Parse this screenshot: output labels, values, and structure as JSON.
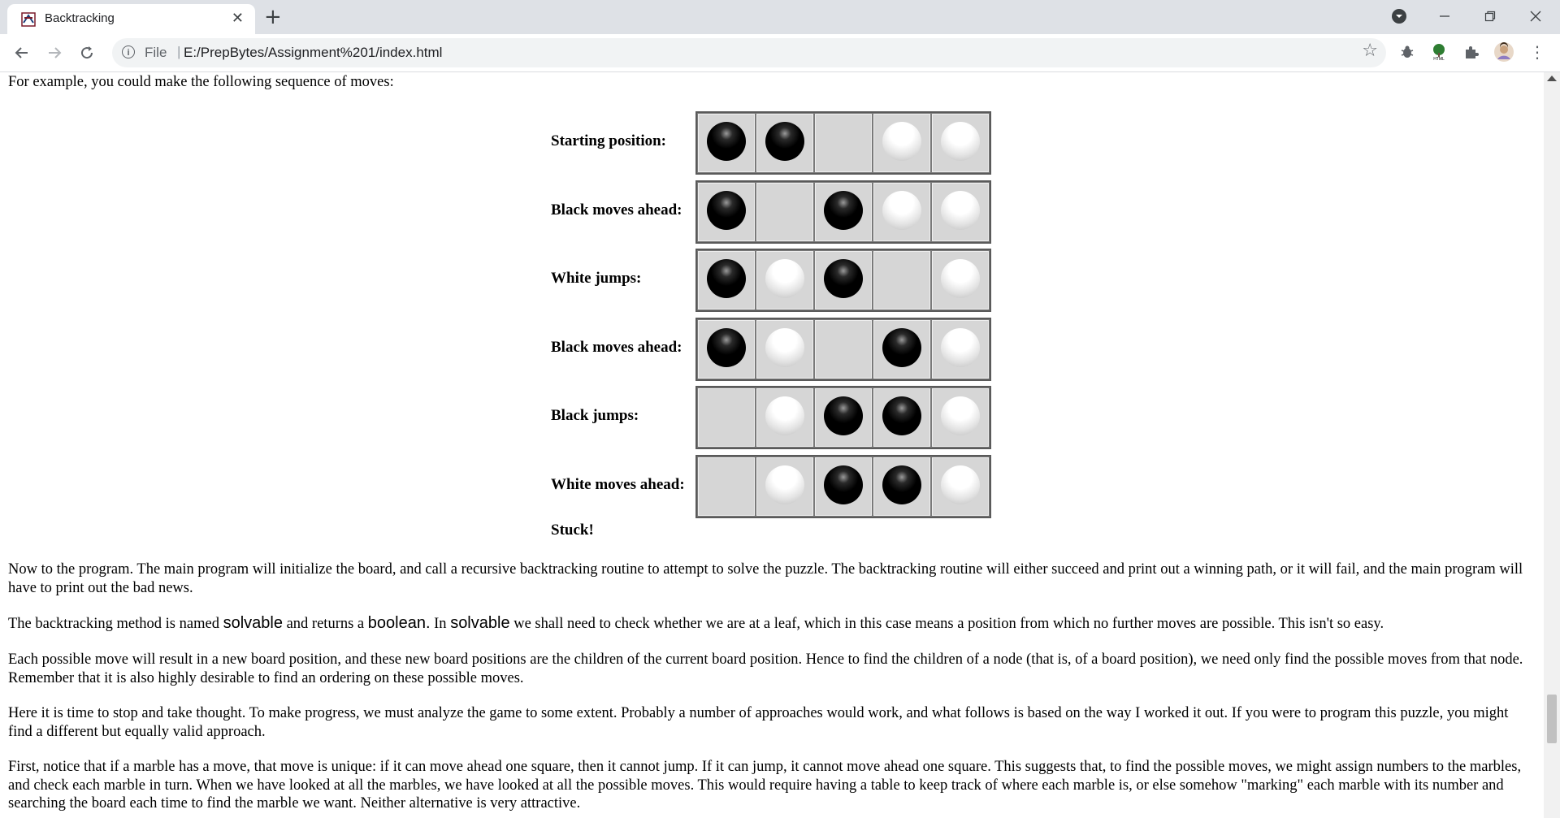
{
  "tab": {
    "title": "Backtracking"
  },
  "address": {
    "scheme_label": "File",
    "separator": "|",
    "url": "E:/PrepBytes/Assignment%201/index.html"
  },
  "content": {
    "intro": "For example, you could make the following sequence of moves:",
    "boards": [
      {
        "label": "Starting position:",
        "cells": [
          "black",
          "black",
          "empty",
          "white",
          "white"
        ]
      },
      {
        "label": "Black moves ahead:",
        "cells": [
          "black",
          "empty",
          "black",
          "white",
          "white"
        ]
      },
      {
        "label": "White jumps:",
        "cells": [
          "black",
          "white",
          "black",
          "empty",
          "white"
        ]
      },
      {
        "label": "Black moves ahead:",
        "cells": [
          "black",
          "white",
          "empty",
          "black",
          "white"
        ]
      },
      {
        "label": "Black jumps:",
        "cells": [
          "empty",
          "white",
          "black",
          "black",
          "white"
        ]
      },
      {
        "label": "White moves ahead:",
        "cells": [
          "empty",
          "white",
          "black",
          "black",
          "white"
        ]
      }
    ],
    "stuck": "Stuck!",
    "p1": "Now to the program. The main program will initialize the board, and call a recursive backtracking routine to attempt to solve the puzzle. The backtracking routine will either succeed and print out a winning path, or it will fail, and the main program will have to print out the bad news.",
    "p2": {
      "a": "The backtracking method is named ",
      "code1": "solvable",
      "b": " and returns a ",
      "code2": "boolean.",
      "c": " In ",
      "code3": "solvable",
      "d": " we shall need to check whether we are at a leaf, which in this case means a position from which no further moves are possible. This isn't so easy."
    },
    "p3": "Each possible move will result in a new board position, and these new board positions are the children of the current board position. Hence to find the children of a node (that is, of a board position), we need only find the possible moves from that node. Remember that it is also highly desirable to find an ordering on these possible moves.",
    "p4": "Here it is time to stop and take thought. To make progress, we must analyze the game to some extent. Probably a number of approaches would work, and what follows is based on the way I worked it out. If you were to program this puzzle, you might find a different but equally valid approach.",
    "p5": "First, notice that if a marble has a move, that move is unique: if it can move ahead one square, then it cannot jump. If it can jump, it cannot move ahead one square. This suggests that, to find the possible moves, we might assign numbers to the marbles, and check each marble in turn. When we have looked at all the marbles, we have looked at all the possible moves. This would require having a table to keep track of where each marble is, or else somehow \"marking\" each marble with its number and searching the board each time to find the marble we want. Neither alternative is very attractive."
  }
}
